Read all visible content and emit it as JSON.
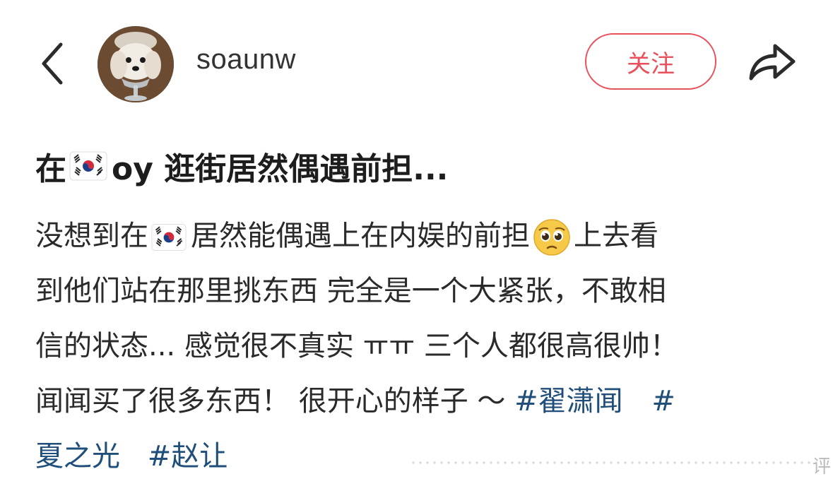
{
  "header": {
    "back_icon": "chevron-left-icon",
    "username": "soaunw",
    "follow_label": "关注",
    "share_icon": "share-arrow-icon",
    "accent_color": "#e8505b"
  },
  "post": {
    "title_prefix": "在",
    "title_suffix": "oy 逛街居然偶遇前担...",
    "body": {
      "l1_a": "没想到在",
      "l1_b": "居然能偶遇上在内娱的前担",
      "l1_c": "上去看",
      "l2": "到他们站在那里挑东西 完全是一个大紧张，不敢相",
      "l3": "信的状态... 感觉很不真实 ㅠㅠ 三个人都很高很帅！",
      "l4": "闻闻买了很多东西！ 很开心的样子 ～ ",
      "tag1": "#翟潇闻",
      "tag2_a": "#",
      "tag2_b": "夏之光",
      "tag3": "#赵让"
    },
    "tag_color": "#1f4e7a"
  },
  "footer": {
    "watermark_char": "评"
  }
}
